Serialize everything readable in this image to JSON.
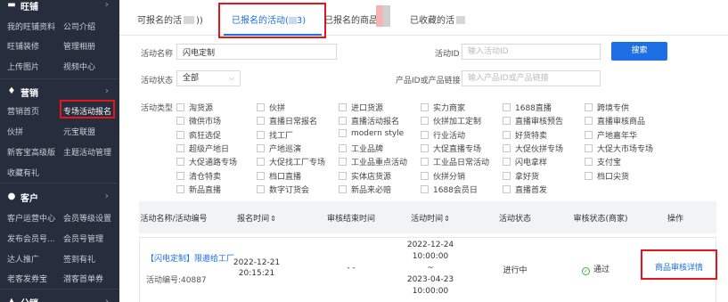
{
  "sidebar": {
    "sections": [
      {
        "title": "旺铺",
        "icon": "shop-icon"
      },
      {
        "title": "营销",
        "icon": "flame-icon"
      },
      {
        "title": "客户",
        "icon": "user-icon"
      },
      {
        "title": "分销",
        "icon": "share-icon"
      }
    ],
    "items": [
      {
        "label": "我的旺铺资料"
      },
      {
        "label": "公司介绍"
      },
      {
        "label": "旺铺装修"
      },
      {
        "label": "管理相册"
      },
      {
        "label": "上传图片"
      },
      {
        "label": "视频中心"
      },
      {
        "label": "营销首页"
      },
      {
        "label": "专场活动报名"
      },
      {
        "label": "伙拼"
      },
      {
        "label": "元宝联盟"
      },
      {
        "label": "新客宝高级版"
      },
      {
        "label": "主题活动管理"
      },
      {
        "label": "收藏有礼"
      },
      {
        "label": "客户运营中心"
      },
      {
        "label": "会员等级设置"
      },
      {
        "label": "发布会员号..."
      },
      {
        "label": "会员号管理"
      },
      {
        "label": "达人推广"
      },
      {
        "label": "签到有礼"
      },
      {
        "label": "老客发券宝"
      },
      {
        "label": "潜客首单券"
      }
    ]
  },
  "tabs": [
    {
      "label": "可报名的活"
    },
    {
      "label": "已报名的活动("
    },
    {
      "label": "已报名的商品"
    },
    {
      "label": "已收藏的活"
    }
  ],
  "tab_suffix": {
    "tab0": "))",
    "tab1": "3)"
  },
  "filters": {
    "activity_name_label": "活动名称",
    "activity_name_value": "闪电定制",
    "activity_id_label": "活动ID",
    "activity_id_placeholder": "输入活动ID",
    "search_label": "搜索",
    "status_label": "活动状态",
    "status_value": "全部",
    "product_label": "产品ID或产品链接",
    "product_placeholder": "输入产品ID或产品链接",
    "type_label": "活动类型"
  },
  "activity_types": [
    [
      "淘货源",
      "伙拼",
      "进口货源",
      "实力商家",
      "1688直播",
      "跨境专供"
    ],
    [
      "微供市场",
      "直播日常报名",
      "直播活动报名",
      "伙拼加工定制",
      "直播审核预告",
      "直播审核商品"
    ],
    [
      "疯狂选促",
      "找工厂",
      "modern style",
      "行业活动",
      "好货特卖",
      "产地嘉年华"
    ],
    [
      "超级产地日",
      "产地巡演",
      "工业品牌",
      "大促直播专场",
      "大促伙拼专场",
      "大促大市场专场"
    ],
    [
      "大促通路专场",
      "大促找工厂专场",
      "工业品重点活动",
      "工业品日常活动",
      "闪电拿样",
      "支付宝"
    ],
    [
      "清仓特卖",
      "档口直播",
      "实体店货源",
      "伙拼分销",
      "拿好货",
      "档口尖货"
    ],
    [
      "新品直播",
      "数字订货会",
      "新品来必赔",
      "1688会员日",
      "直播首发"
    ]
  ],
  "table": {
    "headers": [
      {
        "label": "活动名称/活动编号",
        "sort": ""
      },
      {
        "label": "报名时间",
        "sort": "⇕"
      },
      {
        "label": "审核结束时间",
        "sort": ""
      },
      {
        "label": "活动时间",
        "sort": "⇕"
      },
      {
        "label": "活动状态",
        "sort": ""
      },
      {
        "label": "审核状态(商家)",
        "sort": ""
      },
      {
        "label": "操作",
        "sort": ""
      }
    ],
    "rows": [
      {
        "name": "【闪电定制】限邀给工厂",
        "id_text": "活动编号:40887",
        "signup_date": "2022-12-21",
        "signup_time": "20:15:21",
        "review_end": "- -",
        "start_date": "2022-12-24",
        "start_time": "10:00:00",
        "tilde": "~",
        "end_date": "2023-04-23",
        "end_time": "10:00:00",
        "status": "进行中",
        "review_status": "通过",
        "action": "商品审核详情"
      }
    ]
  }
}
